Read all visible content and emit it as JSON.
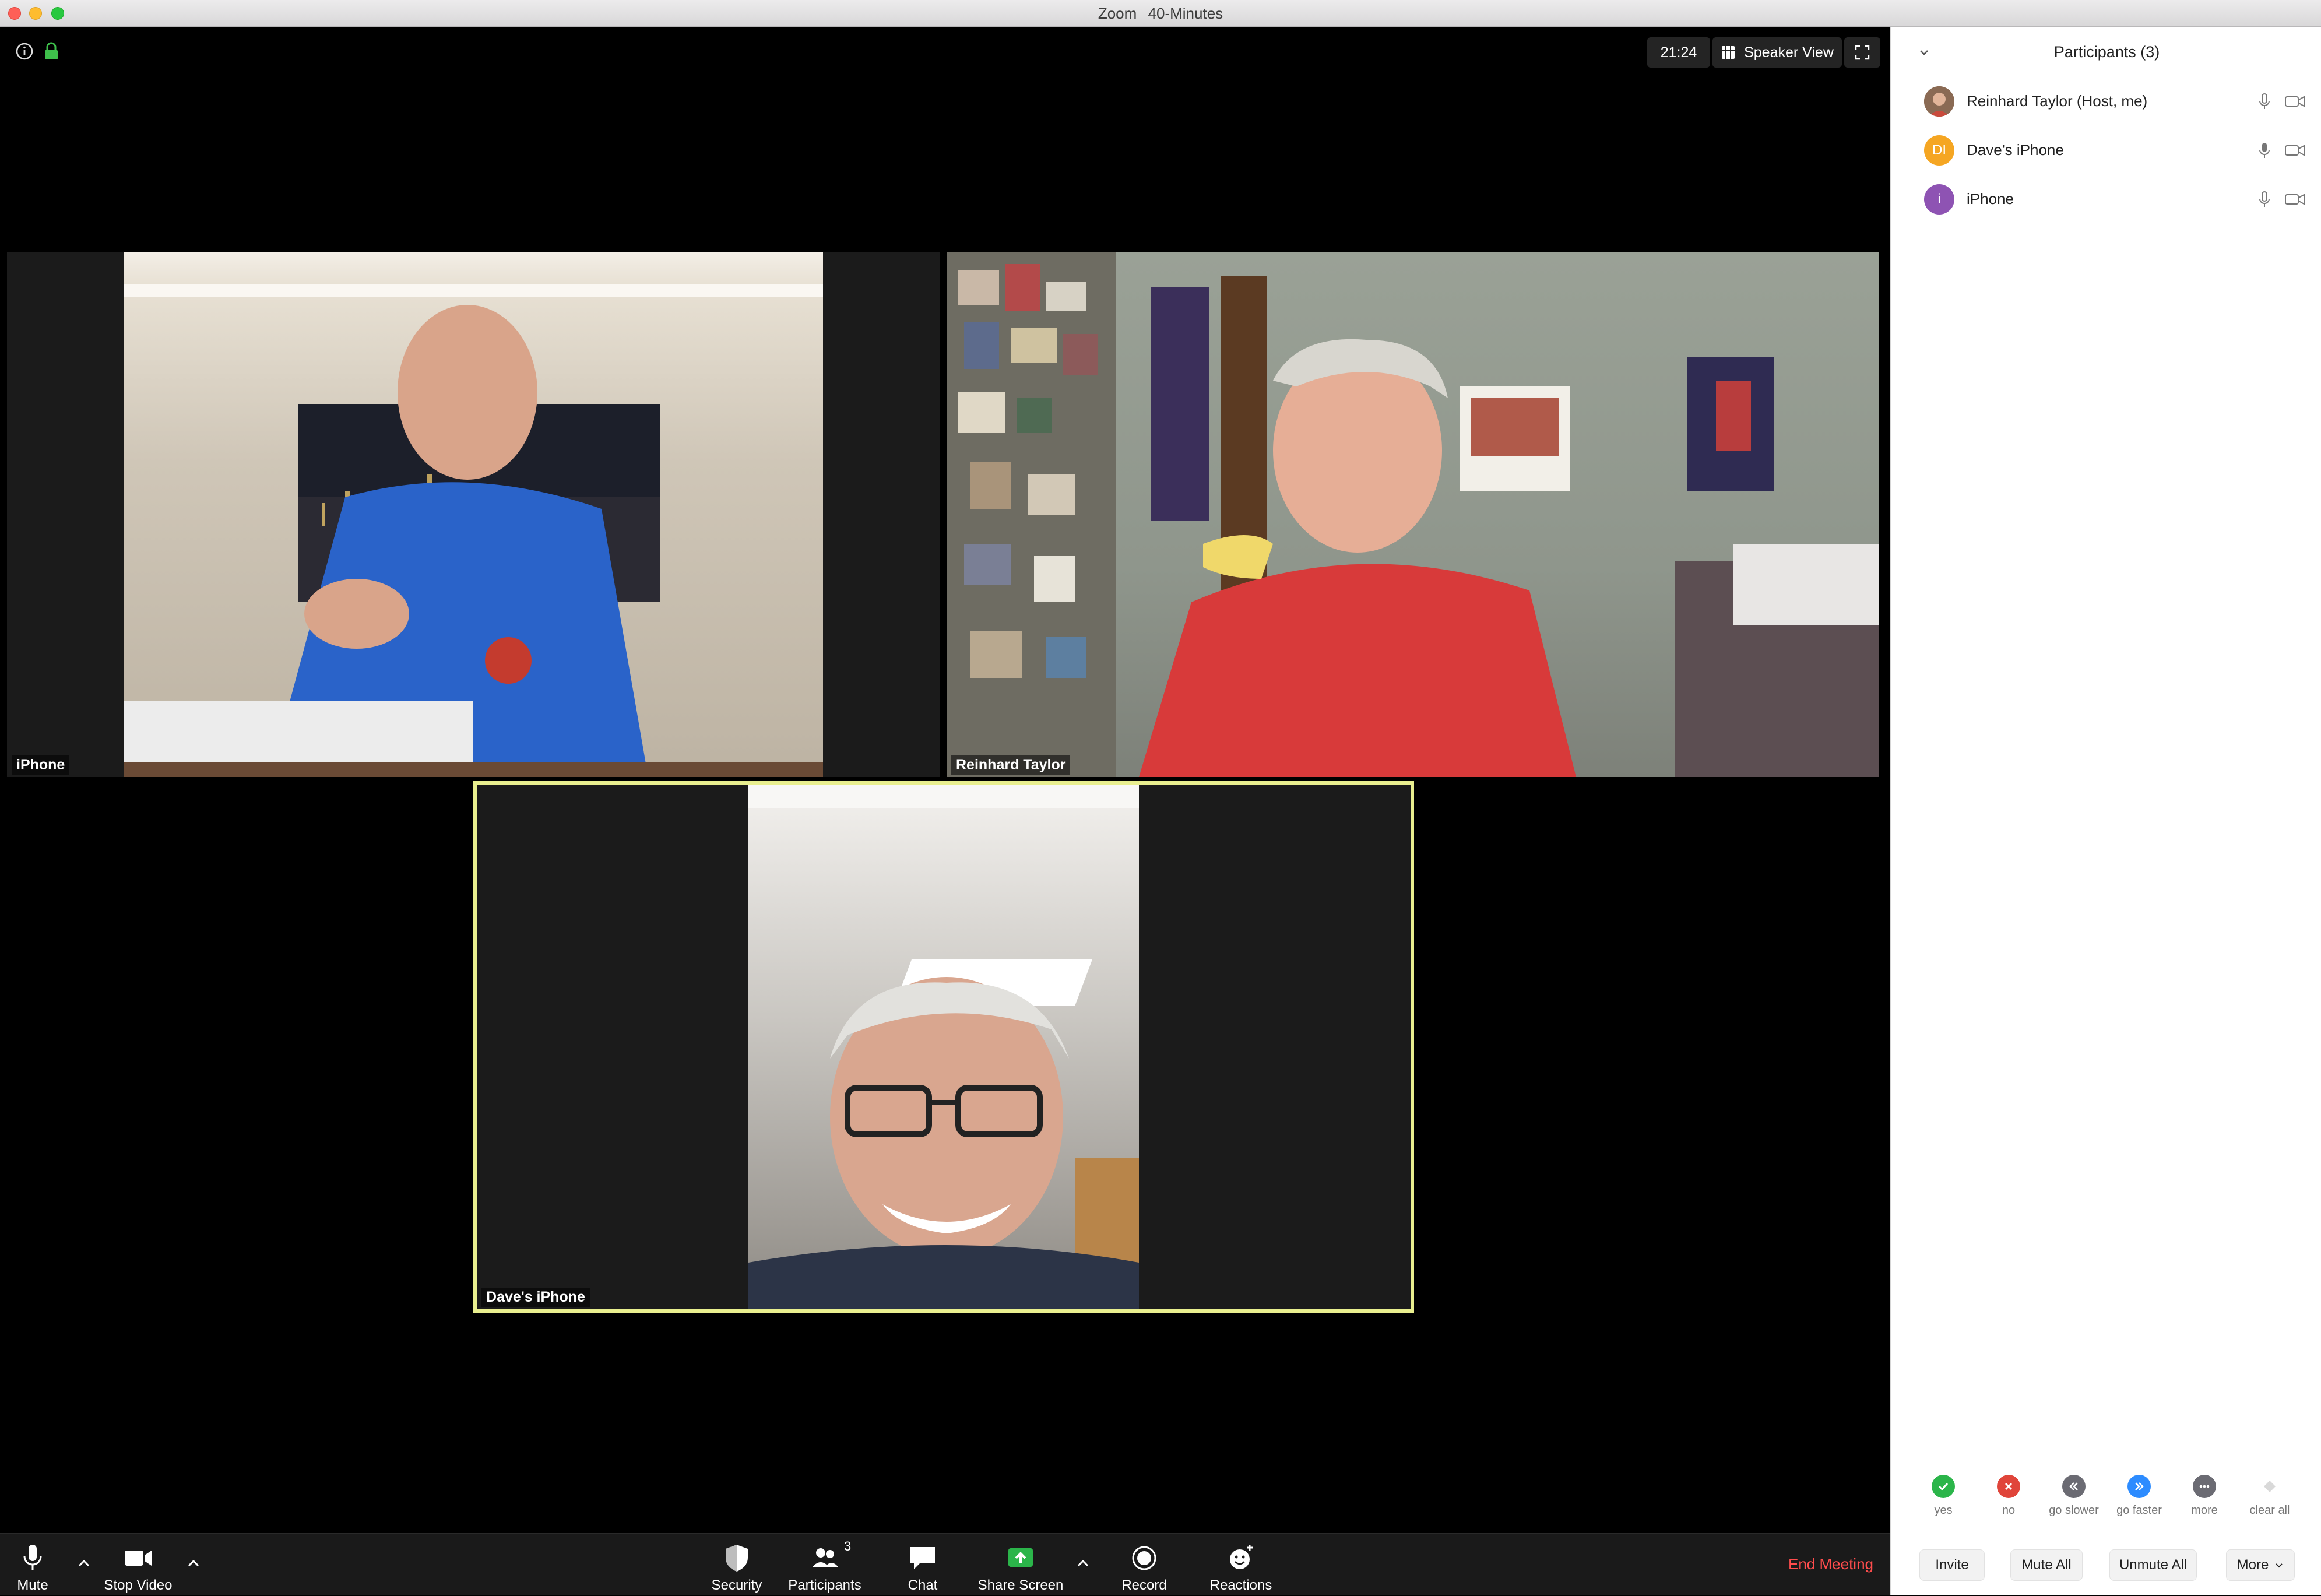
{
  "window": {
    "app_name": "Zoom",
    "subtitle": "40-Minutes"
  },
  "top_bar": {
    "timer": "21:24",
    "view_mode": "Speaker View"
  },
  "tiles": [
    {
      "name": "iPhone"
    },
    {
      "name": "Reinhard Taylor"
    },
    {
      "name": "Dave's iPhone",
      "active_speaker": true
    }
  ],
  "toolbar": {
    "mute": "Mute",
    "stop_video": "Stop Video",
    "security": "Security",
    "participants": "Participants",
    "participants_count": "3",
    "chat": "Chat",
    "share_screen": "Share Screen",
    "record": "Record",
    "reactions": "Reactions",
    "end_meeting": "End Meeting"
  },
  "panel": {
    "title": "Participants (3)",
    "participants": [
      {
        "name": "Reinhard Taylor (Host, me)",
        "avatar": "photo",
        "avatar_color": "#a0734e"
      },
      {
        "name": "Dave's iPhone",
        "initials": "DI",
        "avatar_color": "#f5a623"
      },
      {
        "name": "iPhone",
        "initials": "i",
        "avatar_color": "#8e53b3"
      }
    ],
    "feedback": [
      {
        "label": "yes",
        "icon": "check-icon",
        "color": "#2bb54a"
      },
      {
        "label": "no",
        "icon": "x-icon",
        "color": "#e0453a"
      },
      {
        "label": "go slower",
        "icon": "rewind-icon",
        "color": "#6b6b73"
      },
      {
        "label": "go faster",
        "icon": "fast-forward-icon",
        "color": "#2d8cff"
      },
      {
        "label": "more",
        "icon": "ellipsis-icon",
        "color": "#6b6b73"
      },
      {
        "label": "clear all",
        "icon": "eraser-icon",
        "color": "#c9c9c9"
      }
    ],
    "footer": {
      "invite": "Invite",
      "mute_all": "Mute All",
      "unmute_all": "Unmute All",
      "more": "More"
    }
  },
  "colors": {
    "active_speaker_border": "#e9ef8f",
    "end_meeting": "#ff4d4d",
    "share_screen": "#2bb54a"
  }
}
